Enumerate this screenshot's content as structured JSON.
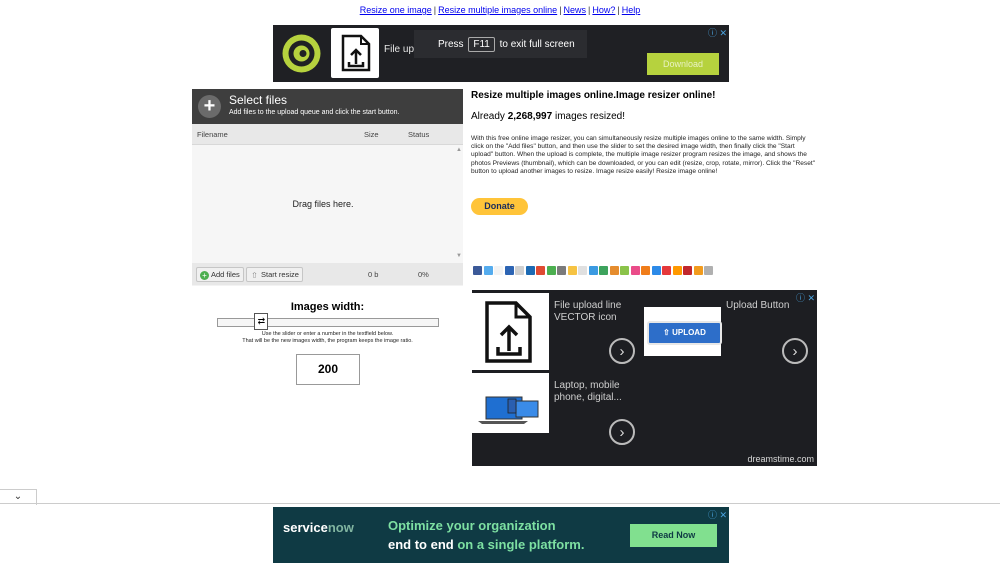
{
  "nav": {
    "links": [
      "Resize one image",
      "Resize multiple images online",
      "News",
      "How?",
      "Help"
    ],
    "sep": "|"
  },
  "top_ad": {
    "text": "File upload line VECTOR icon",
    "button": "Download",
    "info_icons": "ⓘ ✕"
  },
  "toast": {
    "press": "Press",
    "key": "F11",
    "rest": "to exit full screen"
  },
  "uploader": {
    "title": "Select files",
    "subtitle": "Add files to the upload queue and click the start button.",
    "columns": {
      "filename": "Filename",
      "size": "Size",
      "status": "Status"
    },
    "drop_text": "Drag files here.",
    "add_files": "Add files",
    "start_resize": "Start resize",
    "total_size": "0 b",
    "total_percent": "0%"
  },
  "width_widget": {
    "label": "Images width:",
    "help_line1": "Use the slider or enter a number in the textfield below.",
    "help_line2": "That will be the new images width, the program keeps the image ratio.",
    "value": "200",
    "slider_fraction": 0.2
  },
  "info": {
    "title": "Resize multiple images online.Image resizer online!",
    "count_prefix": "Already ",
    "count_value": "2,268,997",
    "count_suffix": " images resized!",
    "description": "With this free online image resizer, you can simultaneously resize multiple images online to the same width. Simply click on the \"Add files\" button, and then use the slider to set the desired image width, then finally click the \"Start upload\" button. When the upload is complete, the multiple image resizer program resizes the image, and shows the photos Previews (thumbnail), which can be downloaded, or you can edit (resize, crop, rotate, mirror). Click the \"Reset\" button to upload another images to resize. Image resize easily! Resize image online!",
    "donate": "Donate",
    "share_colors": [
      "#3b5998",
      "#55acee",
      "#f3f3f3",
      "#2d64b3",
      "#d0d0d0",
      "#1c6ab3",
      "#df4a32",
      "#4caf50",
      "#7b7b7b",
      "#f6c343",
      "#e0e0e0",
      "#3b9ae1",
      "#3da35d",
      "#e58c2e",
      "#8bc34a",
      "#ea4c89",
      "#f07d1a",
      "#2c8ae8",
      "#e5383b",
      "#ff9900",
      "#c1272d",
      "#f29b1d",
      "#b0b0b0"
    ]
  },
  "right_ad": {
    "card1_text": "File upload line VECTOR icon",
    "card2_text": "Upload Button",
    "card3_text": "Laptop, mobile phone, digital...",
    "upload_badge": "UPLOAD",
    "brand": "dreamstime.com",
    "info_icons": "ⓘ ✕",
    "arrow": "›"
  },
  "bottom_ad": {
    "brand_service": "service",
    "brand_now": "now",
    "line1": "Optimize your organization",
    "line2_a": "end to end",
    "line2_b": " on a single platform.",
    "button": "Read Now",
    "info_icons": "ⓘ ✕"
  },
  "collapse": {
    "glyph": "⌄"
  }
}
